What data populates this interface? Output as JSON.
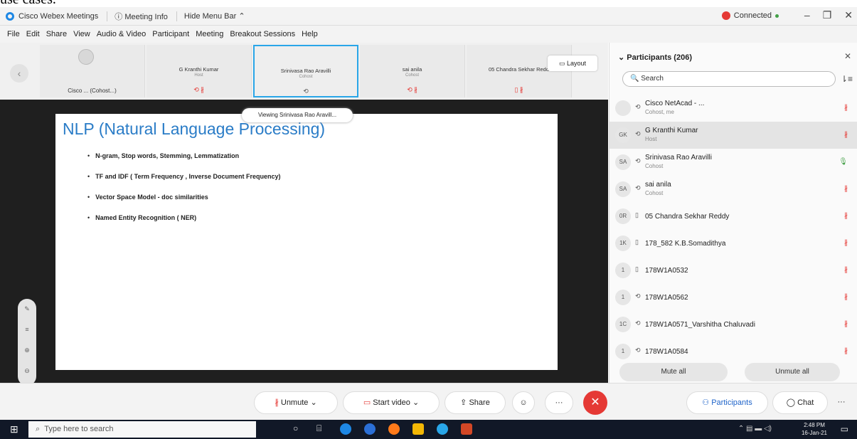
{
  "top_text": "use cases.",
  "titlebar": {
    "app_title": "Cisco Webex Meetings",
    "meeting_info": "Meeting Info",
    "hide_menu": "Hide Menu Bar",
    "connected": "Connected",
    "colors": {
      "connected_red": "#e53935",
      "connected_dot": "#43a047"
    }
  },
  "menu": [
    "File",
    "Edit",
    "Share",
    "View",
    "Audio & Video",
    "Participant",
    "Meeting",
    "Breakout Sessions",
    "Help"
  ],
  "tiles": [
    {
      "name": "",
      "role": "",
      "label": "Cisco ... (Cohost...)"
    },
    {
      "name": "G Kranthi Kumar",
      "role": "Host",
      "label": ""
    },
    {
      "name": "Srinivasa Rao Aravilli",
      "role": "Cohost",
      "label": ""
    },
    {
      "name": "sai anila",
      "role": "Cohost",
      "label": ""
    },
    {
      "name": "05 Chandra Sekhar Redd",
      "role": "",
      "label": ""
    }
  ],
  "layout_label": "Layout",
  "viewing": "Viewing Srinivasa Rao Aravill...",
  "slide": {
    "title": "NLP (Natural Language Processing)",
    "bullets": [
      "N-gram, Stop words, Stemming, Lemmatization",
      "TF and IDF ( Term Frequency , Inverse Document Frequency)",
      "Vector Space Model - doc similarities",
      "Named Entity Recognition ( NER)"
    ]
  },
  "participants_panel": {
    "title": "Participants (206)",
    "search_placeholder": "Search",
    "rows": [
      {
        "initials": "",
        "name": "Cisco NetAcad - ...",
        "role": "Cohost, me"
      },
      {
        "initials": "GK",
        "name": "G Kranthi Kumar",
        "role": "Host"
      },
      {
        "initials": "SA",
        "name": "Srinivasa Rao Aravilli",
        "role": "Cohost"
      },
      {
        "initials": "SA",
        "name": "sai anila",
        "role": "Cohost"
      },
      {
        "initials": "0R",
        "name": "05 Chandra Sekhar Reddy",
        "role": ""
      },
      {
        "initials": "1K",
        "name": "178_582 K.B.Somadithya",
        "role": ""
      },
      {
        "initials": "1",
        "name": "178W1A0532",
        "role": ""
      },
      {
        "initials": "1",
        "name": "178W1A0562",
        "role": ""
      },
      {
        "initials": "1C",
        "name": "178W1A0571_Varshitha Chaluvadi",
        "role": ""
      },
      {
        "initials": "1",
        "name": "178W1A0584",
        "role": ""
      }
    ],
    "mute_all": "Mute all",
    "unmute_all": "Unmute all"
  },
  "controls": {
    "unmute": "Unmute",
    "start_video": "Start video",
    "share": "Share",
    "participants": "Participants",
    "chat": "Chat"
  },
  "taskbar": {
    "search": "Type here to search",
    "time": "2:48 PM",
    "date": "16-Jan-21"
  }
}
